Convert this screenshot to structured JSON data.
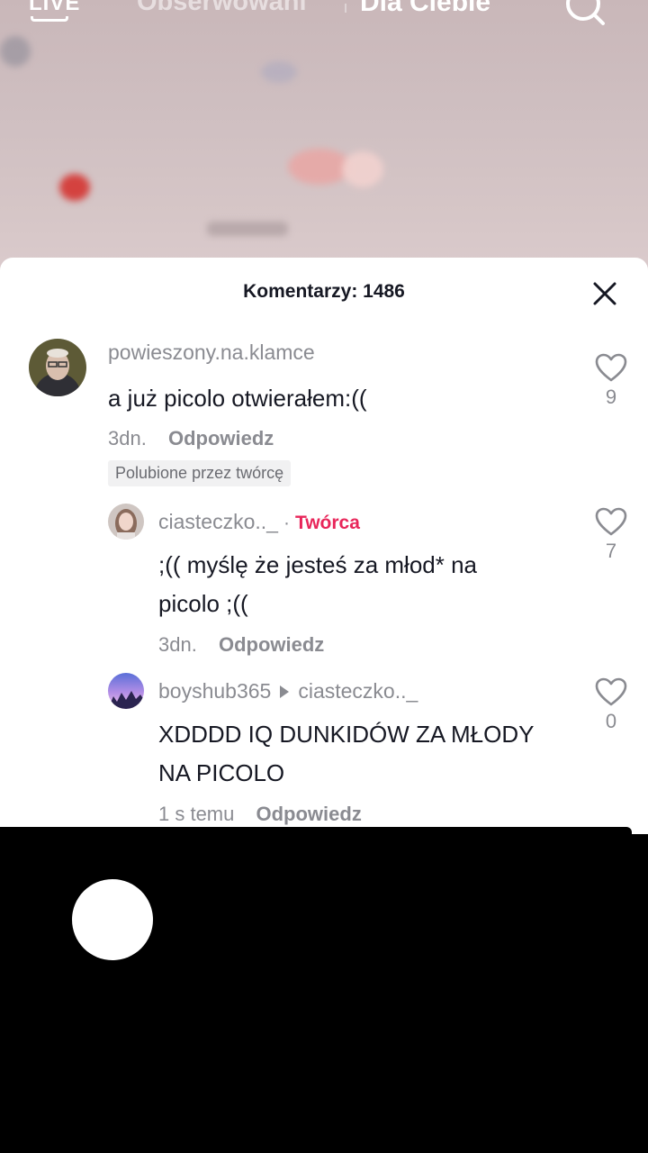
{
  "top_nav": {
    "live_label": "LIVE",
    "following_label": "Obserwowani",
    "for_you_label": "Dla Ciebie"
  },
  "comments_sheet": {
    "title": "Komentarzy: 1486",
    "comments": [
      {
        "username": "powieszony.na.klamce",
        "text": "a już picolo otwierałem:((",
        "time": "3dn.",
        "reply_label": "Odpowiedz",
        "badge": "Polubione przez twórcę",
        "likes": "9"
      },
      {
        "username": "ciasteczko.._",
        "creator_tag": "Twórca",
        "text": ";(( myślę że jesteś za młod* na picolo ;((",
        "time": "3dn.",
        "reply_label": "Odpowiedz",
        "likes": "7"
      },
      {
        "username": "boyshub365",
        "reply_to": "ciasteczko.._",
        "text": "XDDDD IQ DUNKIDÓW ZA MŁODY NA PICOLO",
        "time": "1 s temu",
        "reply_label": "Odpowiedz",
        "likes": "0"
      }
    ]
  },
  "colors": {
    "creator_accent": "#e8265a",
    "secondary_text": "#8a8b91",
    "primary_text": "#161823"
  }
}
